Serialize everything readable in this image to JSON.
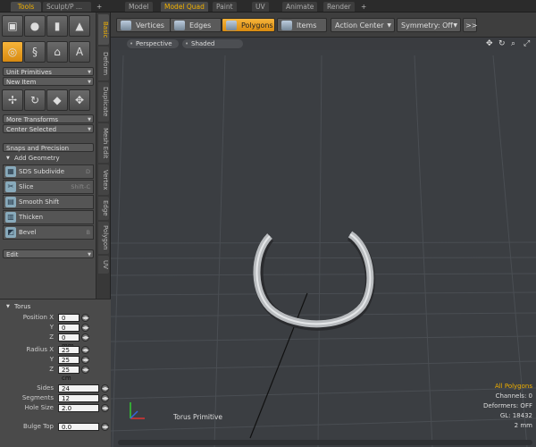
{
  "top_tabs": [
    {
      "label": "Tools",
      "active": true
    },
    {
      "label": "Sculpt/P ...",
      "active": false
    },
    {
      "label": "Model",
      "active": false
    },
    {
      "label": "Model Quad",
      "active": true
    },
    {
      "label": "Paint",
      "active": false
    },
    {
      "label": "UV",
      "active": false
    },
    {
      "label": "Animate",
      "active": false
    },
    {
      "label": "Render",
      "active": false
    }
  ],
  "top_plus": "+",
  "left_panel": {
    "primitive_icons": [
      "cube-icon",
      "sphere-icon",
      "cylinder-icon",
      "cone-icon"
    ],
    "tool_icons": [
      "torus-icon",
      "spiral-icon",
      "bell-icon",
      "text-icon"
    ],
    "unit_primitives": "Unit Primitives",
    "new_item": "New Item",
    "transform_icons": [
      "move-icon",
      "rotate-icon",
      "scale-icon",
      "transform-icon"
    ],
    "more_transforms": "More Transforms",
    "center_selected": "Center Selected",
    "snaps_precision": "Snaps and Precision",
    "add_geometry": "Add Geometry",
    "geometry_items": [
      {
        "label": "SDS Subdivide",
        "shortcut": "D"
      },
      {
        "label": "Slice",
        "shortcut": "Shift-C"
      },
      {
        "label": "Smooth Shift",
        "shortcut": ""
      },
      {
        "label": "Thicken",
        "shortcut": ""
      },
      {
        "label": "Bevel",
        "shortcut": "B"
      }
    ],
    "edit": "Edit"
  },
  "side_tabs": [
    {
      "label": "Basic",
      "active": true
    },
    {
      "label": "Deform",
      "active": false
    },
    {
      "label": "Duplicate",
      "active": false
    },
    {
      "label": "Mesh Edit",
      "active": false
    },
    {
      "label": "Vertex",
      "active": false
    },
    {
      "label": "Edge",
      "active": false
    },
    {
      "label": "Polygon",
      "active": false
    },
    {
      "label": "UV",
      "active": false
    }
  ],
  "properties": {
    "title": "Torus",
    "position_label": "Position X",
    "position": {
      "x": "0 mm",
      "y": "0 mm",
      "z": "0 mm"
    },
    "radius_label": "Radius X",
    "radius": {
      "x": "25 cm",
      "y": "25 cm",
      "z": "25 cm"
    },
    "axis_y": "Y",
    "axis_z": "Z",
    "sides_label": "Sides",
    "sides": "24",
    "segments_label": "Segments",
    "segments": "12",
    "hole_size_label": "Hole Size",
    "hole_size": "2.0",
    "bulge_top_label": "Bulge Top",
    "bulge_top": "0.0"
  },
  "toolbar": {
    "vertices": "Vertices",
    "edges": "Edges",
    "polygons": "Polygons",
    "items": "Items",
    "action_center": "Action Center",
    "symmetry": "Symmetry: Off",
    "more": ">>"
  },
  "viewport": {
    "view": "Perspective",
    "shading": "Shaded",
    "tool_label": "Torus Primitive",
    "stats": {
      "selection": "All Polygons",
      "channels": "Channels: 0",
      "deformers": "Deformers: OFF",
      "gl": "GL: 18432",
      "scale": "2 mm"
    },
    "icons": [
      "move-view-icon",
      "rotate-view-icon",
      "zoom-view-icon",
      "maximize-view-icon"
    ]
  },
  "colors": {
    "accent": "#f0b000",
    "viewport_bg": "#3b3e42",
    "panel_bg": "#4a4a4a"
  }
}
